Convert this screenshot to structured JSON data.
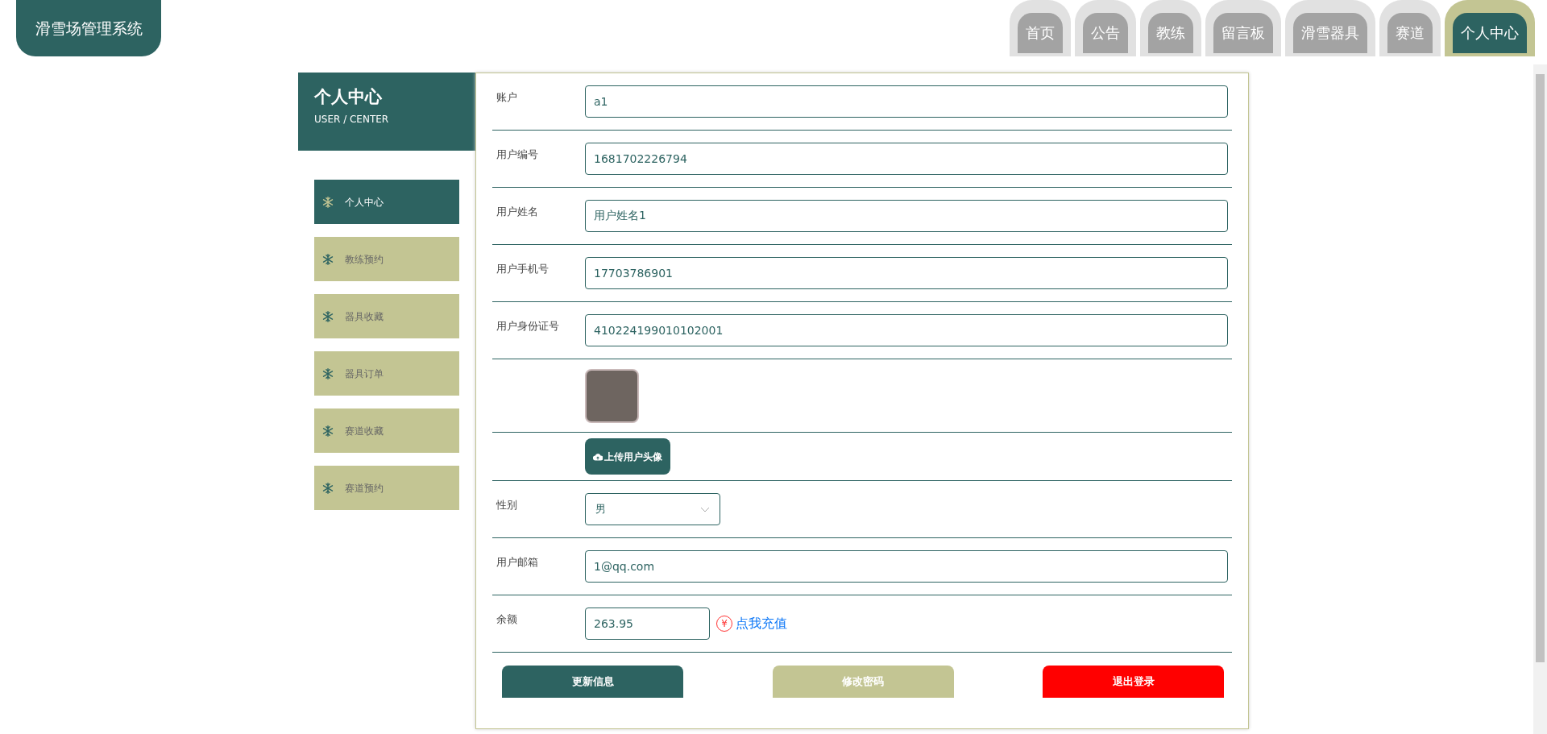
{
  "logo": {
    "title": "滑雪场管理系统"
  },
  "nav": [
    {
      "label": "首页",
      "selected": false
    },
    {
      "label": "公告",
      "selected": false
    },
    {
      "label": "教练",
      "selected": false
    },
    {
      "label": "留言板",
      "selected": false
    },
    {
      "label": "滑雪器具",
      "selected": false
    },
    {
      "label": "赛道",
      "selected": false
    },
    {
      "label": "个人中心",
      "selected": true
    }
  ],
  "sidebar": {
    "title": "个人中心",
    "subtitle": "USER / CENTER",
    "items": [
      {
        "label": "个人中心",
        "selected": true
      },
      {
        "label": "教练预约",
        "selected": false
      },
      {
        "label": "器具收藏",
        "selected": false
      },
      {
        "label": "器具订单",
        "selected": false
      },
      {
        "label": "赛道收藏",
        "selected": false
      },
      {
        "label": "赛道预约",
        "selected": false
      }
    ]
  },
  "form": {
    "fields": [
      {
        "kind": "text",
        "label": "账户",
        "value": "a1"
      },
      {
        "kind": "text",
        "label": "用户编号",
        "value": "1681702226794"
      },
      {
        "kind": "text",
        "label": "用户姓名",
        "value": "用户姓名1"
      },
      {
        "kind": "text",
        "label": "用户手机号",
        "value": "17703786901"
      },
      {
        "kind": "text",
        "label": "用户身份证号",
        "value": "410224199010102001"
      },
      {
        "kind": "image"
      },
      {
        "kind": "upload",
        "button": "上传用户头像"
      },
      {
        "kind": "select",
        "label": "性别",
        "value": "男"
      },
      {
        "kind": "text",
        "label": "用户邮箱",
        "value": "1@qq.com"
      },
      {
        "kind": "balance",
        "label": "余额",
        "value": "263.95",
        "icon": "¥",
        "link": "点我充值"
      }
    ],
    "buttons": [
      {
        "label": "更新信息",
        "kind": "primary"
      },
      {
        "label": "修改密码",
        "kind": "secondary"
      },
      {
        "label": "退出登录",
        "kind": "danger"
      }
    ]
  }
}
